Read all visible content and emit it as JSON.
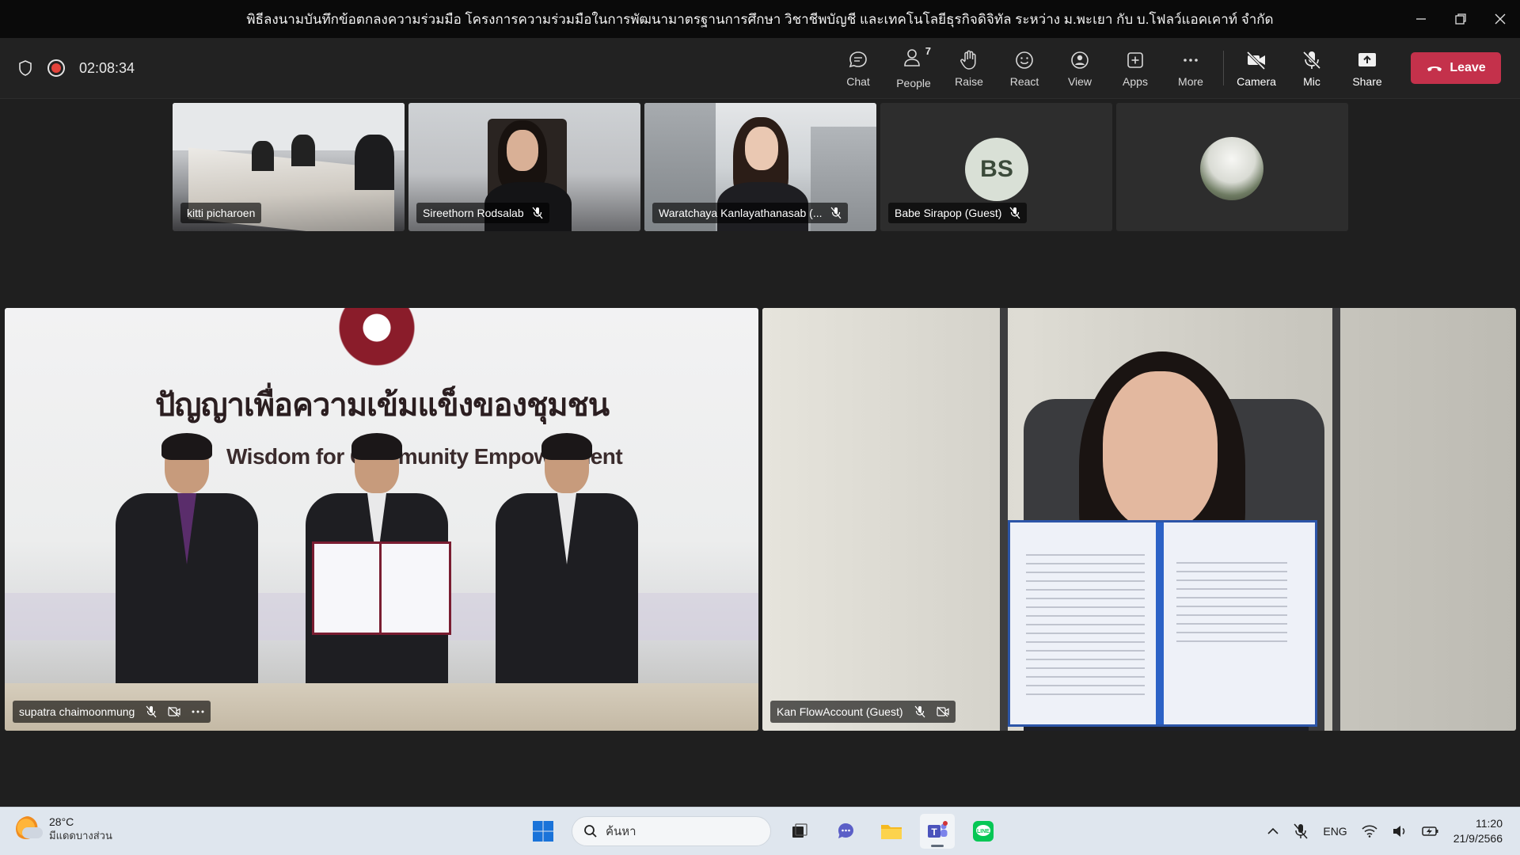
{
  "window": {
    "title": "พิธีลงนามบันทึกข้อตกลงความร่วมมือ โครงการความร่วมมือในการพัฒนามาตรฐานการศึกษา วิชาชีพบัญชี และเทคโนโลยีธุรกิจดิจิทัล ระหว่าง ม.พะเยา กับ บ.โฟลว์แอคเคาท์ จำกัด"
  },
  "meeting": {
    "timer": "02:08:34",
    "toolbar": {
      "chat": "Chat",
      "people": "People",
      "people_count": "7",
      "raise": "Raise",
      "react": "React",
      "view": "View",
      "apps": "Apps",
      "more": "More",
      "camera": "Camera",
      "mic": "Mic",
      "share": "Share",
      "leave": "Leave"
    },
    "thumbnails": [
      {
        "name": "kitti picharoen"
      },
      {
        "name": "Sireethorn Rodsalab"
      },
      {
        "name": "Waratchaya Kanlayathanasab (..."
      },
      {
        "name": "Babe Sirapop (Guest)",
        "initials": "BS"
      },
      {
        "name": ""
      }
    ],
    "videos": [
      {
        "name": "supatra chaimoonmung"
      },
      {
        "name": "Kan FlowAccount (Guest)"
      }
    ],
    "video_text": {
      "banner_thai": "ปัญญาเพื่อความเข้มแข็งของชุมชน",
      "banner_en": "Wisdom for Community Empowerment"
    }
  },
  "taskbar": {
    "temperature": "28°C",
    "weather": "มีแดดบางส่วน",
    "search_placeholder": "ค้นหา",
    "language": "ENG",
    "time": "11:20",
    "date": "21/9/2566"
  },
  "colors": {
    "leave": "#c4314b",
    "recording": "#e2433b",
    "toolbar_bg": "#222222"
  }
}
